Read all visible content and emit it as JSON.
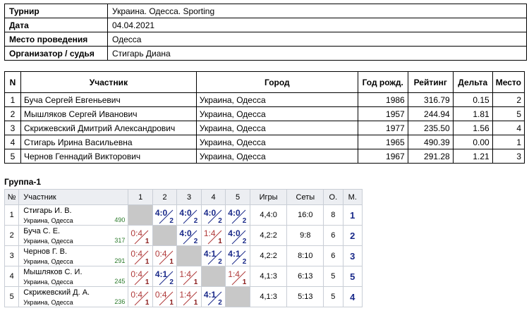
{
  "info": {
    "tournament_label": "Турнир",
    "tournament_value": "Украина. Одесса. Sporting",
    "date_label": "Дата",
    "date_value": "04.04.2021",
    "venue_label": "Место проведения",
    "venue_value": "Одесса",
    "organizer_label": "Организатор / судья",
    "organizer_value": "Стигарь Диана"
  },
  "participants": {
    "headers": [
      "N",
      "Участник",
      "Город",
      "Год рожд.",
      "Рейтинг",
      "Дельта",
      "Место"
    ],
    "rows": [
      {
        "n": "1",
        "name": "Буча Сергей Евгеньевич",
        "city": "Украина, Одесса",
        "year": "1986",
        "rating": "316.79",
        "delta": "0.15",
        "place": "2"
      },
      {
        "n": "2",
        "name": "Мышляков Сергей Иванович",
        "city": "Украина, Одесса",
        "year": "1957",
        "rating": "244.94",
        "delta": "1.81",
        "place": "5"
      },
      {
        "n": "3",
        "name": "Скрижевский Дмитрий Александрович",
        "city": "Украина, Одесса",
        "year": "1977",
        "rating": "235.50",
        "delta": "1.56",
        "place": "4"
      },
      {
        "n": "4",
        "name": "Стигарь Ирина Васильевна",
        "city": "Украина, Одесса",
        "year": "1965",
        "rating": "490.39",
        "delta": "0.00",
        "place": "1"
      },
      {
        "n": "5",
        "name": "Чернов Геннадий Викторович",
        "city": "Украина, Одесса",
        "year": "1967",
        "rating": "291.28",
        "delta": "1.21",
        "place": "3"
      }
    ]
  },
  "group": {
    "title": "Группа-1",
    "headers": [
      "№",
      "Участник",
      "1",
      "2",
      "3",
      "4",
      "5",
      "Игры",
      "Сеты",
      "О.",
      "М."
    ],
    "rows": [
      {
        "n": "1",
        "name": "Стигарь И. В.",
        "city": "Украина, Одесса",
        "rating": "490",
        "cells": [
          null,
          {
            "s": "4:0",
            "p": "2",
            "w": true
          },
          {
            "s": "4:0",
            "p": "2",
            "w": true
          },
          {
            "s": "4:0",
            "p": "2",
            "w": true
          },
          {
            "s": "4:0",
            "p": "2",
            "w": true
          }
        ],
        "games": "4,4:0",
        "sets": "16:0",
        "points": "8",
        "place": "1"
      },
      {
        "n": "2",
        "name": "Буча С. Е.",
        "city": "Украина, Одесса",
        "rating": "317",
        "cells": [
          {
            "s": "0:4",
            "p": "1",
            "w": false
          },
          null,
          {
            "s": "4:0",
            "p": "2",
            "w": true
          },
          {
            "s": "1:4",
            "p": "1",
            "w": false
          },
          {
            "s": "4:0",
            "p": "2",
            "w": true
          }
        ],
        "games": "4,2:2",
        "sets": "9:8",
        "points": "6",
        "place": "2"
      },
      {
        "n": "3",
        "name": "Чернов Г. В.",
        "city": "Украина, Одесса",
        "rating": "291",
        "cells": [
          {
            "s": "0:4",
            "p": "1",
            "w": false
          },
          {
            "s": "0:4",
            "p": "1",
            "w": false
          },
          null,
          {
            "s": "4:1",
            "p": "2",
            "w": true
          },
          {
            "s": "4:1",
            "p": "2",
            "w": true
          }
        ],
        "games": "4,2:2",
        "sets": "8:10",
        "points": "6",
        "place": "3"
      },
      {
        "n": "4",
        "name": "Мышляков С. И.",
        "city": "Украина, Одесса",
        "rating": "245",
        "cells": [
          {
            "s": "0:4",
            "p": "1",
            "w": false
          },
          {
            "s": "4:1",
            "p": "2",
            "w": true
          },
          {
            "s": "1:4",
            "p": "1",
            "w": false
          },
          null,
          {
            "s": "1:4",
            "p": "1",
            "w": false
          }
        ],
        "games": "4,1:3",
        "sets": "6:13",
        "points": "5",
        "place": "5"
      },
      {
        "n": "5",
        "name": "Скрижевский Д. А.",
        "city": "Украина, Одесса",
        "rating": "236",
        "cells": [
          {
            "s": "0:4",
            "p": "1",
            "w": false
          },
          {
            "s": "0:4",
            "p": "1",
            "w": false
          },
          {
            "s": "1:4",
            "p": "1",
            "w": false
          },
          {
            "s": "4:1",
            "p": "2",
            "w": true
          },
          null
        ],
        "games": "4,1:3",
        "sets": "5:13",
        "points": "5",
        "place": "4"
      }
    ]
  }
}
